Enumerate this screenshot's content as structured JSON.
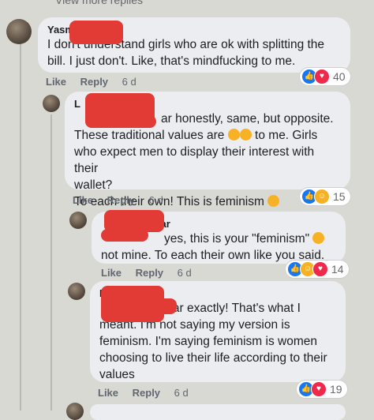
{
  "topcut": "View more replies",
  "comments": [
    {
      "name": "Yasmi",
      "text": "I don't understand girls who are ok with splitting the bill. I just don't. Like, that's mindfucking to me.",
      "like": "Like",
      "reply": "Reply",
      "time": "6 d",
      "reactions": "40"
    },
    {
      "name": "L",
      "text_lines": [
        "ar honestly, same, but opposite.",
        "These traditional values are",
        "to me. Girls",
        "who expect men to display their interest with their",
        "wallet?",
        "To each their own! This is feminism"
      ],
      "like": "Like",
      "reply": "Reply",
      "time": "6 d",
      "reactions": "15"
    },
    {
      "name": "mar",
      "text_lines": [
        "yes, this is your \"feminism\"",
        "not mine. To each their own like you said."
      ],
      "like": "Like",
      "reply": "Reply",
      "time": "6 d",
      "reactions": "14"
    },
    {
      "name": "L",
      "text_lines": [
        "mar exactly! That's what I",
        "meant. I'm not saying my version is",
        "feminism. I'm saying feminism is women",
        "choosing to live their life according to their",
        "values"
      ],
      "like": "Like",
      "reply": "Reply",
      "time": "6 d",
      "reactions": "19"
    }
  ],
  "colors": {
    "like": "#1877f2",
    "love": "#f02849",
    "haha": "#f7b125",
    "redaction": "#e23a35"
  }
}
